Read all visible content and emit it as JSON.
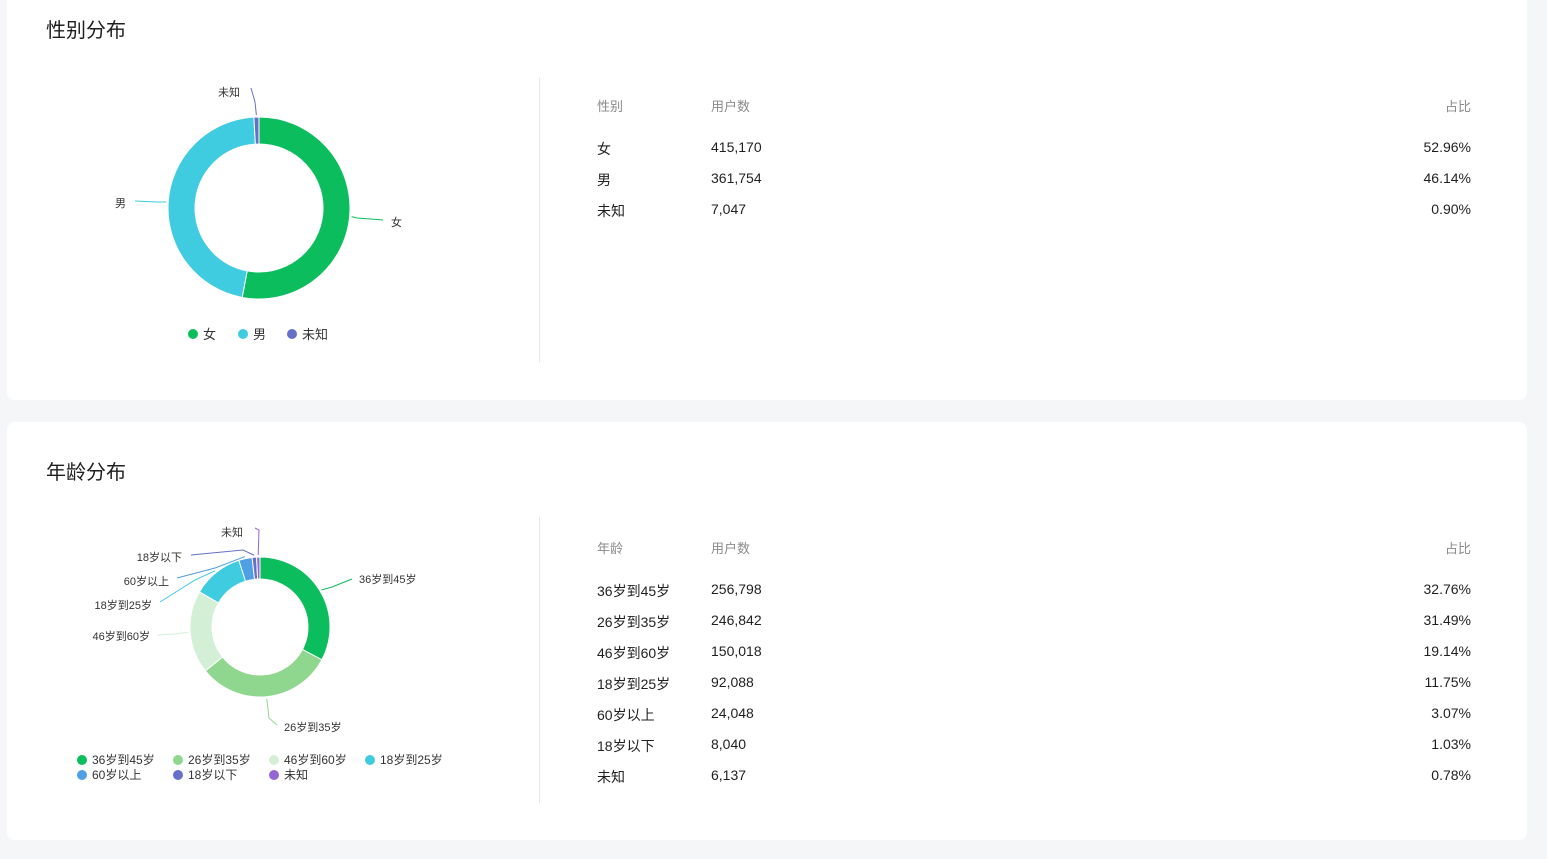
{
  "sections": {
    "gender": {
      "title": "性别分布",
      "table": {
        "headers": [
          "性别",
          "用户数",
          "占比"
        ],
        "rows": [
          [
            "女",
            "415,170",
            "52.96%"
          ],
          [
            "男",
            "361,754",
            "46.14%"
          ],
          [
            "未知",
            "7,047",
            "0.90%"
          ]
        ]
      }
    },
    "age": {
      "title": "年龄分布",
      "table": {
        "headers": [
          "年龄",
          "用户数",
          "占比"
        ],
        "rows": [
          [
            "36岁到45岁",
            "256,798",
            "32.76%"
          ],
          [
            "26岁到35岁",
            "246,842",
            "31.49%"
          ],
          [
            "46岁到60岁",
            "150,018",
            "19.14%"
          ],
          [
            "18岁到25岁",
            "92,088",
            "11.75%"
          ],
          [
            "60岁以上",
            "24,048",
            "3.07%"
          ],
          [
            "18岁以下",
            "8,040",
            "1.03%"
          ],
          [
            "未知",
            "6,137",
            "0.78%"
          ]
        ]
      }
    }
  },
  "chart_data": [
    {
      "type": "pie",
      "variant": "donut",
      "categories": [
        "女",
        "男",
        "未知"
      ],
      "values": [
        415170,
        361754,
        7047
      ],
      "colors": [
        "#0bbd5c",
        "#3fcbe0",
        "#6670c9"
      ],
      "legend": "bottom"
    },
    {
      "type": "pie",
      "variant": "donut",
      "categories": [
        "36岁到45岁",
        "26岁到35岁",
        "46岁到60岁",
        "18岁到25岁",
        "60岁以上",
        "18岁以下",
        "未知"
      ],
      "values": [
        256798,
        246842,
        150018,
        92088,
        24048,
        8040,
        6137
      ],
      "colors": [
        "#0bbd5c",
        "#8fd68f",
        "#d3efd6",
        "#3fcbe0",
        "#4e9fe3",
        "#6670c9",
        "#9466d1"
      ],
      "legend": "bottom"
    }
  ]
}
